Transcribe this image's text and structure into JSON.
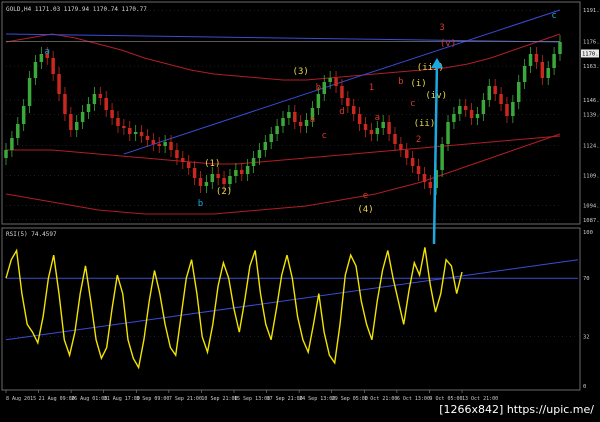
{
  "header": {
    "main_title": "GOLD,H4 1171.03 1179.94 1170.74 1170.77",
    "rsi_title": "RSI(5) 74.4597"
  },
  "watermark": "[1266x842] https://upic.me/",
  "colors": {
    "background": "#000000",
    "grid": "#3a3a3a",
    "axis_text": "#cfcfcf",
    "bull": "#3aa83a",
    "bear": "#c8281e",
    "envelope": "#b01e28",
    "trendline": "#3b4cd8",
    "rsi": "#f2e400",
    "cyan": "#1ea8e0",
    "wave_yellow": "#e8d84a",
    "wave_red": "#d83a2a"
  },
  "chart_data": [
    {
      "type": "candlestick",
      "symbol": "GOLD",
      "timeframe": "H4",
      "y_ticks": [
        1191.9,
        1176.27,
        1163.95,
        1146.96,
        1139.65,
        1124.35,
        1109.29,
        1094.25,
        1087.1
      ],
      "price_tag": "1170.27",
      "x_ticks": [
        "8 Aug 2015",
        "21 Aug 09:00",
        "26 Aug 01:00",
        "31 Aug 17:00",
        "3 Sep 09:00",
        "7 Sep 21:00",
        "10 Sep 21:00",
        "15 Sep 13:00",
        "17 Sep 21:00",
        "24 Sep 13:00",
        "29 Sep 05:00",
        "1 Oct 21:00",
        "6 Oct 13:00",
        "9 Oct 05:00",
        "13 Oct 21:00"
      ],
      "close_series": [
        1122,
        1128,
        1135,
        1144,
        1158,
        1166,
        1170,
        1168,
        1160,
        1150,
        1140,
        1132,
        1136,
        1141,
        1145,
        1150,
        1148,
        1142,
        1138,
        1134,
        1133,
        1130,
        1131,
        1129,
        1127,
        1125,
        1124,
        1126,
        1122,
        1118,
        1116,
        1113,
        1108,
        1104,
        1106,
        1110,
        1108,
        1105,
        1109,
        1112,
        1110,
        1114,
        1118,
        1122,
        1126,
        1130,
        1134,
        1138,
        1141,
        1136,
        1134,
        1137,
        1143,
        1150,
        1156,
        1158,
        1154,
        1148,
        1144,
        1140,
        1135,
        1132,
        1130,
        1133,
        1136,
        1130,
        1125,
        1122,
        1118,
        1114,
        1110,
        1106,
        1103,
        1112,
        1125,
        1136,
        1140,
        1144,
        1142,
        1138,
        1140,
        1147,
        1154,
        1150,
        1145,
        1139,
        1146,
        1156,
        1164,
        1170,
        1166,
        1158,
        1163,
        1170,
        1176
      ],
      "envelope_upper": [
        1176,
        1178,
        1180,
        1178,
        1175,
        1172,
        1168,
        1165,
        1162,
        1160,
        1159,
        1158,
        1157,
        1157,
        1158,
        1159,
        1160,
        1161,
        1162,
        1163,
        1165,
        1168,
        1172,
        1176,
        1180
      ],
      "envelope_lower": [
        1122,
        1122,
        1122,
        1121,
        1120,
        1119,
        1118,
        1117,
        1116,
        1115,
        1115,
        1116,
        1117,
        1118,
        1119,
        1120,
        1121,
        1122,
        1123,
        1124,
        1125,
        1126,
        1127,
        1128,
        1129
      ],
      "envelope_low2": [
        1100,
        1098,
        1096,
        1094,
        1092,
        1091,
        1090,
        1090,
        1090,
        1090,
        1091,
        1092,
        1093,
        1094,
        1096,
        1098,
        1100,
        1103,
        1106,
        1110,
        1114,
        1118,
        1122,
        1126,
        1130
      ],
      "trendlines": [
        {
          "from": [
            0,
            1180
          ],
          "to": [
            94,
            1176
          ]
        },
        {
          "from": [
            20,
            1120
          ],
          "to": [
            94,
            1192
          ]
        }
      ],
      "wave_labels": [
        {
          "text": "a",
          "x": 7,
          "y": 1170,
          "color": "cyan"
        },
        {
          "text": "b",
          "x": 33,
          "y": 1094,
          "color": "cyan"
        },
        {
          "text": "c",
          "x": 93,
          "y": 1188,
          "color": "cyan"
        },
        {
          "text": "(1)",
          "x": 35,
          "y": 1114,
          "color": "wave_yellow"
        },
        {
          "text": "(2)",
          "x": 37,
          "y": 1100,
          "color": "wave_yellow"
        },
        {
          "text": "(3)",
          "x": 50,
          "y": 1160,
          "color": "wave_yellow"
        },
        {
          "text": "(4)",
          "x": 61,
          "y": 1091,
          "color": "wave_yellow"
        },
        {
          "text": "b",
          "x": 53,
          "y": 1152,
          "color": "wave_red"
        },
        {
          "text": "a",
          "x": 52,
          "y": 1136,
          "color": "wave_red"
        },
        {
          "text": "c",
          "x": 54,
          "y": 1128,
          "color": "wave_red"
        },
        {
          "text": "d",
          "x": 57,
          "y": 1140,
          "color": "wave_red"
        },
        {
          "text": "e",
          "x": 61,
          "y": 1098,
          "color": "wave_red"
        },
        {
          "text": "1",
          "x": 62,
          "y": 1152,
          "color": "wave_red"
        },
        {
          "text": "a",
          "x": 63,
          "y": 1137,
          "color": "wave_red"
        },
        {
          "text": "b",
          "x": 67,
          "y": 1155,
          "color": "wave_red"
        },
        {
          "text": "c",
          "x": 69,
          "y": 1144,
          "color": "wave_red"
        },
        {
          "text": "2",
          "x": 70,
          "y": 1126,
          "color": "wave_red"
        },
        {
          "text": "(i)",
          "x": 70,
          "y": 1154,
          "color": "wave_yellow"
        },
        {
          "text": "(ii)",
          "x": 71,
          "y": 1134,
          "color": "wave_yellow"
        },
        {
          "text": "(iii)",
          "x": 72,
          "y": 1162,
          "color": "wave_yellow"
        },
        {
          "text": "(iv)",
          "x": 73,
          "y": 1148,
          "color": "wave_yellow"
        },
        {
          "text": "(v)",
          "x": 75,
          "y": 1174,
          "color": "wave_red"
        },
        {
          "text": "3",
          "x": 74,
          "y": 1182,
          "color": "wave_red"
        }
      ]
    },
    {
      "type": "line",
      "name": "RSI(5)",
      "y_ticks": [
        100,
        70,
        32,
        0
      ],
      "values": [
        70,
        82,
        88,
        60,
        40,
        35,
        28,
        45,
        70,
        85,
        60,
        30,
        20,
        35,
        60,
        78,
        55,
        30,
        18,
        25,
        50,
        72,
        60,
        30,
        18,
        12,
        30,
        55,
        75,
        60,
        40,
        25,
        20,
        45,
        70,
        82,
        60,
        32,
        22,
        40,
        65,
        80,
        70,
        50,
        35,
        55,
        78,
        88,
        60,
        40,
        30,
        50,
        72,
        85,
        70,
        45,
        30,
        22,
        40,
        60,
        35,
        20,
        15,
        40,
        72,
        85,
        78,
        55,
        40,
        30,
        55,
        75,
        88,
        70,
        55,
        40,
        62,
        80,
        72,
        90,
        66,
        48,
        60,
        82,
        78,
        60,
        74
      ],
      "trendlines": [
        {
          "from": [
            0,
            70
          ],
          "to": [
            86,
            70
          ]
        },
        {
          "from": [
            0,
            30
          ],
          "to": [
            86,
            82
          ]
        }
      ]
    }
  ]
}
